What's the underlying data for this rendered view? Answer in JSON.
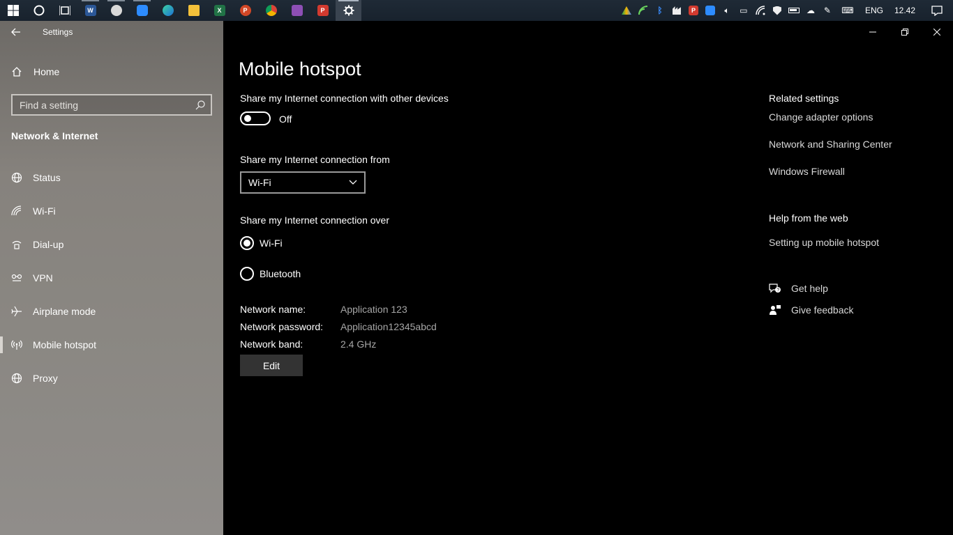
{
  "taskbar": {
    "apps": [
      {
        "name": "word",
        "letter": "W",
        "color": "#2b5797"
      },
      {
        "name": "clock-app",
        "letter": "",
        "color": "#8e8e8e"
      },
      {
        "name": "zoom",
        "letter": "",
        "color": "#2d8cff"
      },
      {
        "name": "edge",
        "letter": "",
        "color": "#1e9de0"
      },
      {
        "name": "file-explorer",
        "letter": "",
        "color": "#f3c13a"
      },
      {
        "name": "excel",
        "letter": "X",
        "color": "#217346"
      },
      {
        "name": "powerpoint",
        "letter": "P",
        "color": "#d24726"
      },
      {
        "name": "chrome",
        "letter": "",
        "color": "#e8b41b"
      },
      {
        "name": "winrar",
        "letter": "",
        "color": "#8d4fb5"
      },
      {
        "name": "psiphon",
        "letter": "P",
        "color": "#d23a2f"
      }
    ],
    "lang": "ENG",
    "time": "12.42"
  },
  "sidebar": {
    "app_title": "Settings",
    "home_label": "Home",
    "search_placeholder": "Find a setting",
    "section_title": "Network & Internet",
    "items": [
      {
        "label": "Status",
        "icon": "globe-icon"
      },
      {
        "label": "Wi-Fi",
        "icon": "wifi-icon"
      },
      {
        "label": "Dial-up",
        "icon": "dialup-icon"
      },
      {
        "label": "VPN",
        "icon": "vpn-icon"
      },
      {
        "label": "Airplane mode",
        "icon": "airplane-icon"
      },
      {
        "label": "Mobile hotspot",
        "icon": "hotspot-icon"
      },
      {
        "label": "Proxy",
        "icon": "globe-icon"
      }
    ]
  },
  "main": {
    "title": "Mobile hotspot",
    "share_label": "Share my Internet connection with other devices",
    "toggle_state": "Off",
    "from_label": "Share my Internet connection from",
    "from_value": "Wi-Fi",
    "over_label": "Share my Internet connection over",
    "over_options": [
      "Wi-Fi",
      "Bluetooth"
    ],
    "network_name_label": "Network name:",
    "network_name": "Application 123",
    "network_password_label": "Network password:",
    "network_password": "Application12345abcd",
    "network_band_label": "Network band:",
    "network_band": "2.4 GHz",
    "edit_label": "Edit"
  },
  "related": {
    "title": "Related settings",
    "links": [
      "Change adapter options",
      "Network and Sharing Center",
      "Windows Firewall"
    ],
    "help_title": "Help from the web",
    "help_link": "Setting up mobile hotspot",
    "get_help": "Get help",
    "give_feedback": "Give feedback"
  }
}
